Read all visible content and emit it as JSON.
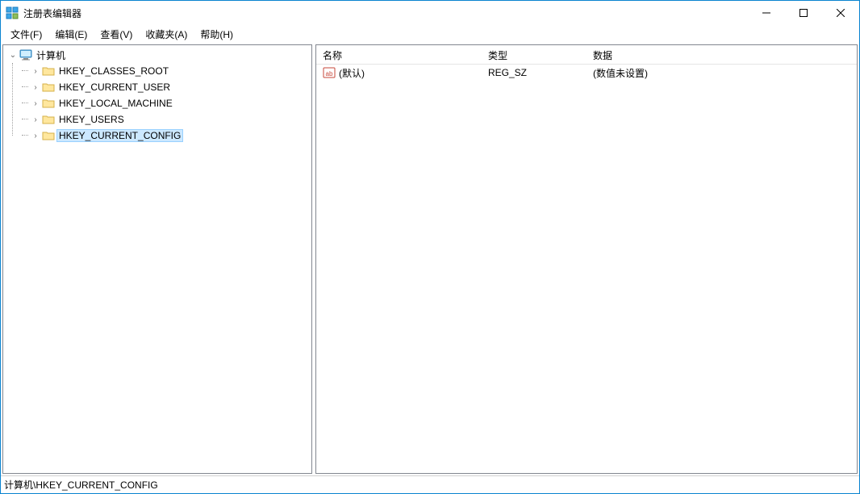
{
  "window": {
    "title": "注册表编辑器"
  },
  "menu": {
    "file": "文件(F)",
    "edit": "编辑(E)",
    "view": "查看(V)",
    "favorites": "收藏夹(A)",
    "help": "帮助(H)"
  },
  "tree": {
    "root": "计算机",
    "items": [
      {
        "label": "HKEY_CLASSES_ROOT",
        "selected": false
      },
      {
        "label": "HKEY_CURRENT_USER",
        "selected": false
      },
      {
        "label": "HKEY_LOCAL_MACHINE",
        "selected": false
      },
      {
        "label": "HKEY_USERS",
        "selected": false
      },
      {
        "label": "HKEY_CURRENT_CONFIG",
        "selected": true
      }
    ]
  },
  "list": {
    "headers": {
      "name": "名称",
      "type": "类型",
      "data": "数据"
    },
    "rows": [
      {
        "name": "(默认)",
        "type": "REG_SZ",
        "data": "(数值未设置)"
      }
    ]
  },
  "status": {
    "path": "计算机\\HKEY_CURRENT_CONFIG"
  }
}
